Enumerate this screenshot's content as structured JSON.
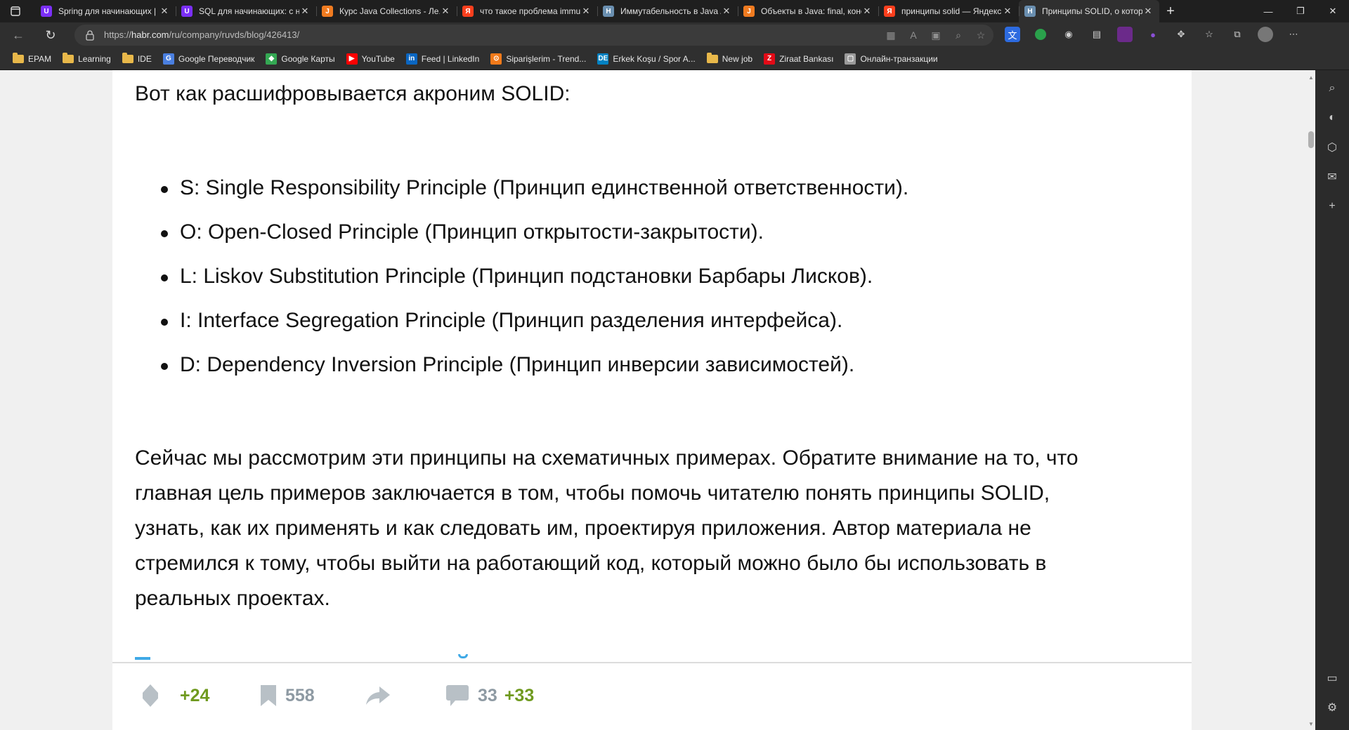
{
  "browser": {
    "tabs": [
      {
        "title": "Spring для начинающих | ...",
        "favicon": "purple-u",
        "color": "#7b2ff7",
        "glyph": "U",
        "active": false
      },
      {
        "title": "SQL для начинающих: с н...",
        "favicon": "purple-u",
        "color": "#7b2ff7",
        "glyph": "U",
        "active": false
      },
      {
        "title": "Курс Java Collections - Ле...",
        "favicon": "javarush",
        "color": "#f07b20",
        "glyph": "J",
        "active": false
      },
      {
        "title": "что такое проблема immu...",
        "favicon": "yandex",
        "color": "#fc3f1d",
        "glyph": "Я",
        "active": false
      },
      {
        "title": "Иммутабельность в Java /...",
        "favicon": "habr",
        "color": "#6a8fb0",
        "glyph": "H",
        "active": false
      },
      {
        "title": "Объекты в Java: final, конс...",
        "favicon": "javarush",
        "color": "#f07b20",
        "glyph": "J",
        "active": false
      },
      {
        "title": "принципы solid — Яндекс...",
        "favicon": "yandex",
        "color": "#fc3f1d",
        "glyph": "Я",
        "active": false
      },
      {
        "title": "Принципы SOLID, о котор...",
        "favicon": "habr",
        "color": "#6a8fb0",
        "glyph": "H",
        "active": true
      }
    ],
    "url_prefix": "https://",
    "url_host": "habr.com",
    "url_path": "/ru/company/ruvds/blog/426413/",
    "bookmarks": [
      {
        "label": "EPAM",
        "icon": "folder"
      },
      {
        "label": "Learning",
        "icon": "folder"
      },
      {
        "label": "IDE",
        "icon": "folder"
      },
      {
        "label": "Google Переводчик",
        "icon": "translate",
        "color": "#4a7fe0",
        "glyph": "G"
      },
      {
        "label": "Google Карты",
        "icon": "maps",
        "color": "#34a853",
        "glyph": "◆"
      },
      {
        "label": "YouTube",
        "icon": "youtube",
        "color": "#ff0000",
        "glyph": "▶"
      },
      {
        "label": "Feed | LinkedIn",
        "icon": "linkedin",
        "color": "#0a66c2",
        "glyph": "in"
      },
      {
        "label": "Siparişlerim - Trend...",
        "icon": "trendyol",
        "color": "#f27a1a",
        "glyph": "⊙"
      },
      {
        "label": "Erkek Koşu / Spor A...",
        "icon": "decathlon",
        "color": "#0082c3",
        "glyph": "DE"
      },
      {
        "label": "New job",
        "icon": "folder"
      },
      {
        "label": "Ziraat Bankası",
        "icon": "ziraat",
        "color": "#e30a17",
        "glyph": "Z"
      },
      {
        "label": "Онлайн-транзакции",
        "icon": "page",
        "color": "#9a9a9a",
        "glyph": "▢"
      }
    ]
  },
  "article": {
    "intro": "Вот как расшифровывается акроним SOLID:",
    "principles": [
      "S: Single Responsibility Principle (Принцип единственной ответственности).",
      "O: Open-Closed Principle (Принцип открытости-закрытости).",
      "L: Liskov Substitution Principle (Принцип подстановки Барбары Лисков).",
      "I: Interface Segregation Principle (Принцип разделения интерфейса).",
      "D: Dependency Inversion Principle (Принцип инверсии зависимостей)."
    ],
    "paragraph_lines": [
      "Сейчас мы рассмотрим эти принципы на схематичных примерах. Обратите внимание на то, что",
      "главная цель примеров заключается в том, чтобы помочь читателю понять принципы SOLID,",
      "узнать, как их применять и как следовать им, проектируя приложения. Автор материала не",
      "стремился к тому, чтобы выйти на работающий код, который можно было бы использовать в",
      "реальных проектах."
    ]
  },
  "actions": {
    "rating": "+24",
    "bookmarks": "558",
    "comments": "33",
    "new_comments": "+33"
  },
  "colors": {
    "rating_green": "#6f9a1f",
    "icon_grey": "#b8c0c6",
    "accent_blue": "#3fa9e6"
  }
}
